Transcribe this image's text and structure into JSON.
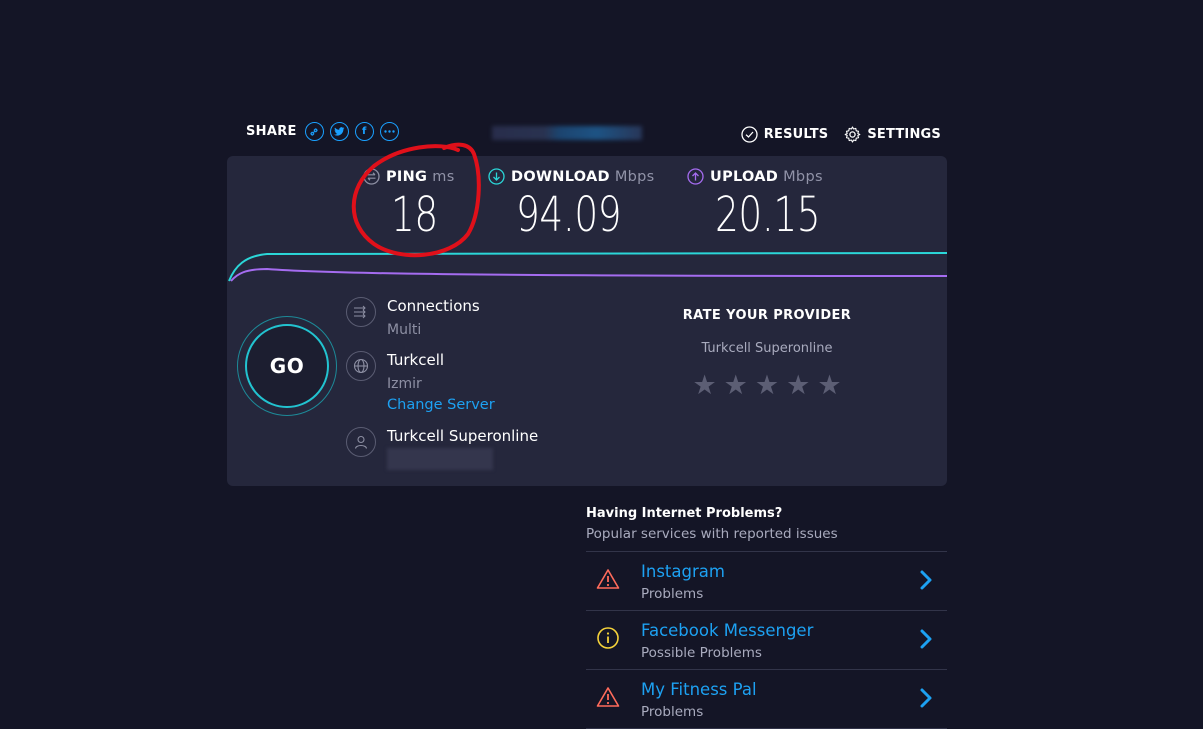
{
  "share": {
    "label": "SHARE",
    "buttons": [
      "link-icon",
      "twitter-icon",
      "facebook-icon",
      "more-icon"
    ],
    "facebook_glyph": "f"
  },
  "nav": {
    "results_label": "RESULTS",
    "settings_label": "SETTINGS"
  },
  "metrics": {
    "ping": {
      "label": "PING",
      "unit": "ms",
      "value": "18",
      "icon": "ping-icon"
    },
    "download": {
      "label": "DOWNLOAD",
      "unit": "Mbps",
      "value": "94.09",
      "icon": "download-arrow-icon"
    },
    "upload": {
      "label": "UPLOAD",
      "unit": "Mbps",
      "value": "20.15",
      "icon": "upload-arrow-icon"
    }
  },
  "go_button": {
    "label": "GO"
  },
  "connection": {
    "connections_title": "Connections",
    "connections_value": "Multi",
    "server_name": "Turkcell",
    "server_location": "Izmir",
    "change_server_label": "Change Server",
    "provider_name": "Turkcell Superonline"
  },
  "rating": {
    "title": "RATE YOUR PROVIDER",
    "provider": "Turkcell Superonline",
    "stars_total": 5,
    "stars_selected": 0
  },
  "problems": {
    "title": "Having Internet Problems?",
    "subtitle": "Popular services with reported issues",
    "items": [
      {
        "name": "Instagram",
        "status": "Problems",
        "icon": "warning-icon"
      },
      {
        "name": "Facebook Messenger",
        "status": "Possible Problems",
        "icon": "info-icon"
      },
      {
        "name": "My Fitness Pal",
        "status": "Problems",
        "icon": "warning-icon"
      }
    ]
  },
  "colors": {
    "background": "#141526",
    "panel": "#25273c",
    "download_accent": "#2bd6d8",
    "upload_accent": "#a56cf0",
    "link": "#1da1f2",
    "annotation": "#e0101a"
  }
}
